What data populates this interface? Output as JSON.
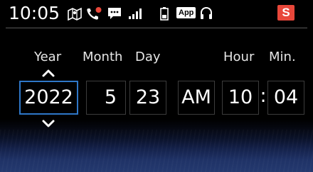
{
  "status_bar": {
    "time": "10:05",
    "app_label": "App",
    "s_label": "S",
    "icons": [
      "navigation-icon",
      "missed-call-icon",
      "message-icon",
      "signal-icon",
      "battery-icon",
      "app-icon",
      "headset-icon",
      "s-icon"
    ],
    "accent_color": "#e8473a"
  },
  "date_time": {
    "labels": {
      "year": "Year",
      "month": "Month",
      "day": "Day",
      "hour": "Hour",
      "minute": "Min."
    },
    "values": {
      "year": "2022",
      "month": "5",
      "day": "23",
      "ampm": "AM",
      "hour": "10",
      "minute": "04"
    },
    "separator": ":",
    "selected_field": "year",
    "selection_color": "#2e77c8"
  }
}
